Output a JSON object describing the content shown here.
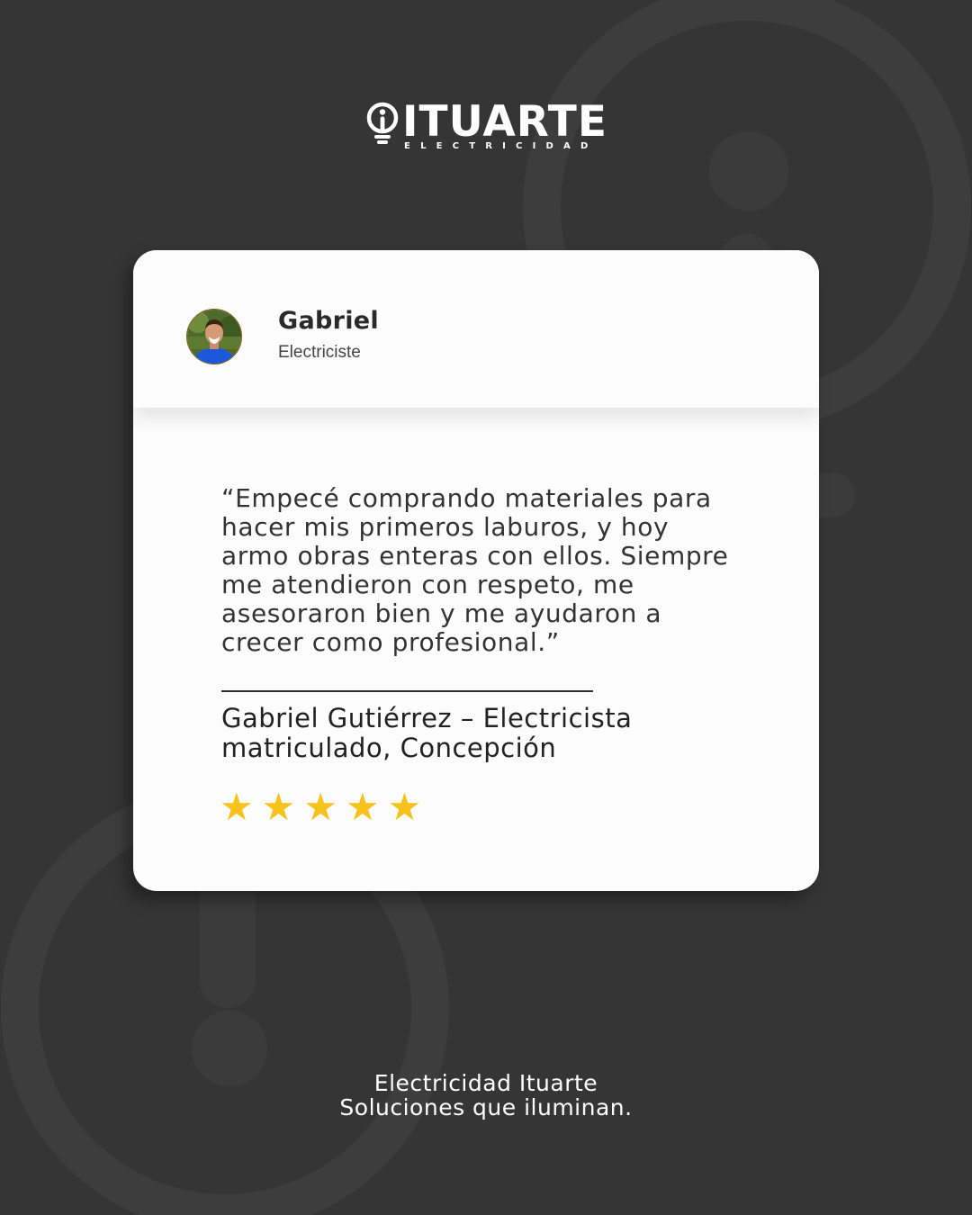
{
  "brand": {
    "name": "ITUARTE",
    "subtitle": "ELECTRICIDAD",
    "icon": "lightbulb-icon"
  },
  "review": {
    "reviewer_name": "Gabriel",
    "reviewer_role": "Electriciste",
    "avatar": "avatar-photo",
    "quote": "“Empecé comprando materiales para hacer mis primeros laburos, y hoy armo obras enteras con ellos. Siempre me atendieron con respeto, me asesoraron bien y me ayudaron a crecer como profesional.”",
    "author": "Gabriel Gutiérrez – Electricista matriculado, Concepción",
    "rating": 5,
    "rating_max": 5,
    "star_glyph": "★",
    "star_color": "#f7c21b"
  },
  "footer": {
    "line1": "Electricidad Ituarte",
    "line2": "Soluciones que iluminan."
  },
  "colors": {
    "background": "#353535",
    "card": "#fcfcfc",
    "text": "#333333"
  }
}
